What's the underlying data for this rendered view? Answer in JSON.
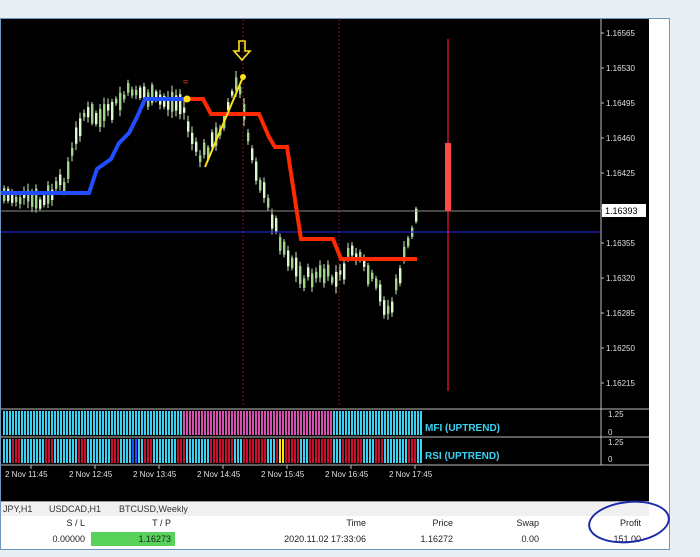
{
  "chart": {
    "price_labels": [
      "1.16565",
      "1.16530",
      "1.16495",
      "1.16460",
      "1.16425",
      "1.16390",
      "1.16355",
      "1.16320",
      "1.16285",
      "1.16250",
      "1.16215"
    ],
    "current_price": "1.16393",
    "time_labels": [
      "2 Nov 11:45",
      "2 Nov 12:45",
      "2 Nov 13:45",
      "2 Nov 14:45",
      "2 Nov 15:45",
      "2 Nov 16:45",
      "2 Nov 17:45"
    ],
    "mfi_label": "MFI (UPTREND)",
    "rsi_label": "RSI (UPTREND)",
    "mfi_scale": [
      "1.25",
      "0"
    ],
    "rsi_scale": [
      "1.25",
      "0"
    ],
    "colors": {
      "background": "#000000",
      "candle": "#d8f5c0",
      "blue_line": "#1f4dff",
      "red_line": "#ff2a00",
      "yellow": "#ffe11a",
      "cyan": "#3bd2f2",
      "magenta": "#d64fb2",
      "crimson": "#c8102e"
    }
  },
  "tabs": [
    "JPY,H1",
    "USDCAD,H1",
    "BTCUSD,Weekly"
  ],
  "terminal": {
    "headers": {
      "sl": "S / L",
      "tp": "T / P",
      "time": "Time",
      "price": "Price",
      "swap": "Swap",
      "profit": "Profit"
    },
    "row": {
      "sl": "0.00000",
      "tp": "1.16273",
      "time": "2020.11.02 17:33:06",
      "price": "1.16272",
      "swap": "0.00",
      "profit": "151.00"
    }
  }
}
